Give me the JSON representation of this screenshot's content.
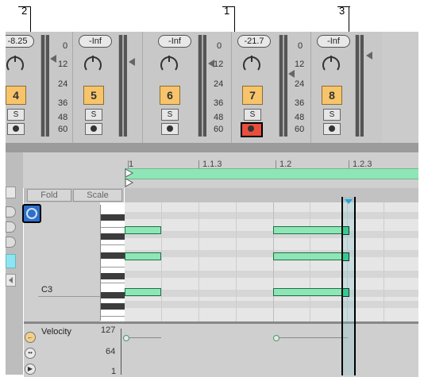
{
  "callouts": {
    "c1": "1",
    "c2": "2",
    "c3": "3"
  },
  "mixer": {
    "strips": [
      {
        "volume": "-8.25",
        "track": "4",
        "solo": "S"
      },
      {
        "volume": "-Inf",
        "track": "5",
        "solo": "S"
      },
      {
        "volume": "-Inf",
        "track": "6",
        "solo": "S"
      },
      {
        "volume": "-21.7",
        "track": "7",
        "solo": "S",
        "arm_active": true
      },
      {
        "volume": "-Inf",
        "track": "8",
        "solo": "S"
      }
    ],
    "scale": [
      "0",
      "12",
      "24",
      "36",
      "48",
      "60"
    ]
  },
  "timeline": {
    "markers": [
      "1",
      "1.1.3",
      "1.2",
      "1.2.3"
    ]
  },
  "editor": {
    "fold_label": "Fold",
    "scale_label": "Scale",
    "key_label": "C3",
    "velocity_label": "Velocity",
    "velocity_ticks": [
      "127",
      "64",
      "1"
    ]
  },
  "colors": {
    "note": "#8ee6b6",
    "note_end": "#1fcf7a",
    "arm_active": "#e94f3e",
    "track_number": "#f7c46c",
    "playhead_marker": "#2aa3d8"
  }
}
